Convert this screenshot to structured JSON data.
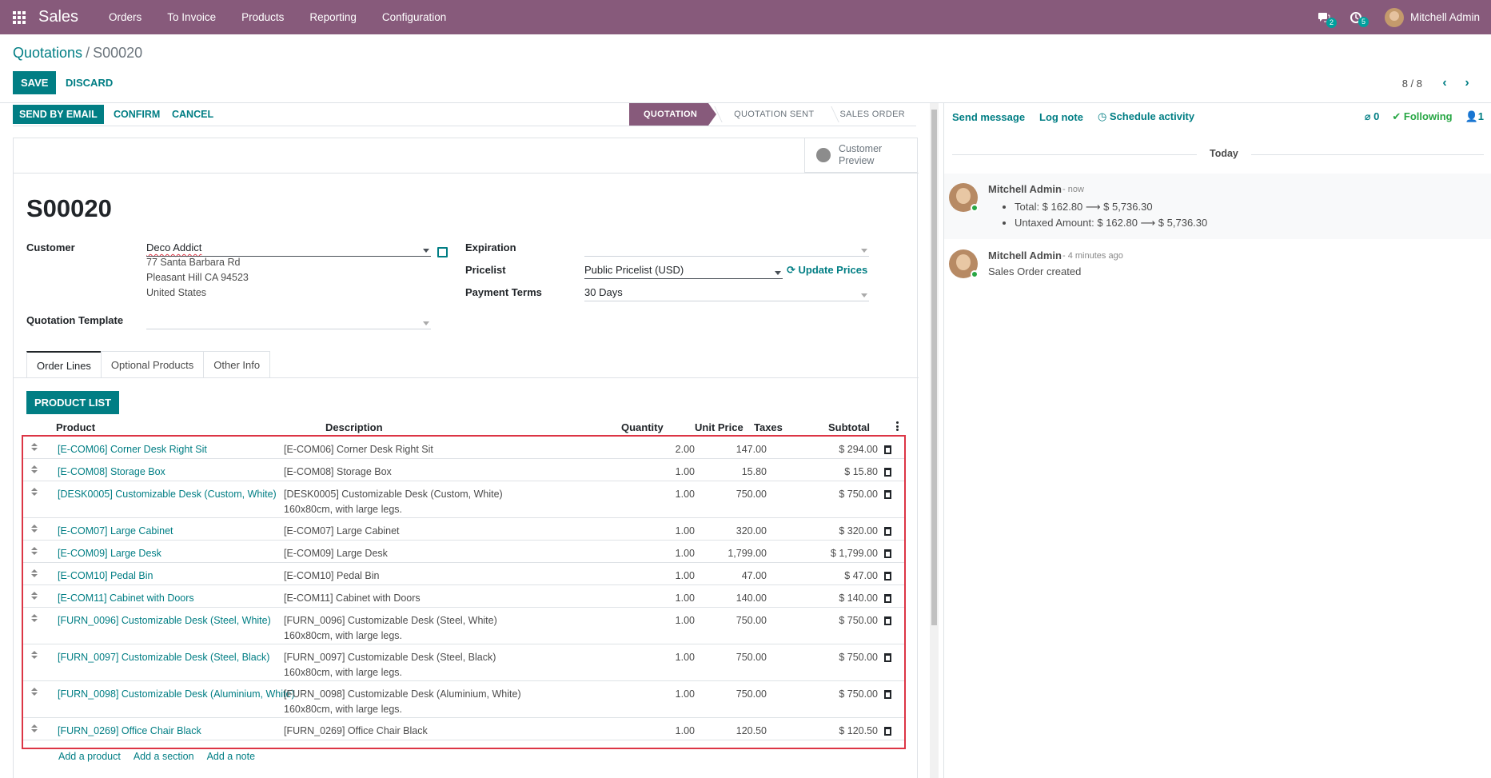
{
  "navbar": {
    "brand": "Sales",
    "menu": [
      "Orders",
      "To Invoice",
      "Products",
      "Reporting",
      "Configuration"
    ],
    "messages_badge": "2",
    "activities_badge": "5",
    "user": "Mitchell Admin"
  },
  "control": {
    "breadcrumb_parent": "Quotations",
    "breadcrumb_sep": "/",
    "breadcrumb_current": "S00020",
    "save": "SAVE",
    "discard": "DISCARD",
    "pager": "8 / 8"
  },
  "statusbar": {
    "send_email": "SEND BY EMAIL",
    "confirm": "CONFIRM",
    "cancel": "CANCEL",
    "stages": [
      "QUOTATION",
      "QUOTATION SENT",
      "SALES ORDER"
    ]
  },
  "form": {
    "customer_preview_1": "Customer",
    "customer_preview_2": "Preview",
    "title": "S00020",
    "customer_label": "Customer",
    "customer_value": "Deco Addict",
    "address": [
      "77 Santa Barbara Rd",
      "Pleasant Hill CA 94523",
      "United States"
    ],
    "quotation_template_label": "Quotation Template",
    "expiration_label": "Expiration",
    "pricelist_label": "Pricelist",
    "pricelist_value": "Public Pricelist (USD)",
    "update_prices": "Update Prices",
    "payment_terms_label": "Payment Terms",
    "payment_terms_value": "30 Days"
  },
  "tabs": [
    "Order Lines",
    "Optional Products",
    "Other Info"
  ],
  "order_lines": {
    "product_list_button": "PRODUCT LIST",
    "headers": {
      "product": "Product",
      "description": "Description",
      "quantity": "Quantity",
      "unit_price": "Unit Price",
      "taxes": "Taxes",
      "subtotal": "Subtotal"
    },
    "rows": [
      {
        "product": "[E-COM06] Corner Desk Right Sit",
        "desc1": "[E-COM06] Corner Desk Right Sit",
        "desc2": "",
        "qty": "2.00",
        "price": "147.00",
        "subtotal": "$ 294.00"
      },
      {
        "product": "[E-COM08] Storage Box",
        "desc1": "[E-COM08] Storage Box",
        "desc2": "",
        "qty": "1.00",
        "price": "15.80",
        "subtotal": "$ 15.80"
      },
      {
        "product": "[DESK0005] Customizable Desk (Custom, White)",
        "desc1": "[DESK0005] Customizable Desk (Custom, White)",
        "desc2": "160x80cm, with large legs.",
        "qty": "1.00",
        "price": "750.00",
        "subtotal": "$ 750.00"
      },
      {
        "product": "[E-COM07] Large Cabinet",
        "desc1": "[E-COM07] Large Cabinet",
        "desc2": "",
        "qty": "1.00",
        "price": "320.00",
        "subtotal": "$ 320.00"
      },
      {
        "product": "[E-COM09] Large Desk",
        "desc1": "[E-COM09] Large Desk",
        "desc2": "",
        "qty": "1.00",
        "price": "1,799.00",
        "subtotal": "$ 1,799.00"
      },
      {
        "product": "[E-COM10] Pedal Bin",
        "desc1": "[E-COM10] Pedal Bin",
        "desc2": "",
        "qty": "1.00",
        "price": "47.00",
        "subtotal": "$ 47.00"
      },
      {
        "product": "[E-COM11] Cabinet with Doors",
        "desc1": "[E-COM11] Cabinet with Doors",
        "desc2": "",
        "qty": "1.00",
        "price": "140.00",
        "subtotal": "$ 140.00"
      },
      {
        "product": "[FURN_0096] Customizable Desk (Steel, White)",
        "desc1": "[FURN_0096] Customizable Desk (Steel, White)",
        "desc2": "160x80cm, with large legs.",
        "qty": "1.00",
        "price": "750.00",
        "subtotal": "$ 750.00"
      },
      {
        "product": "[FURN_0097] Customizable Desk (Steel, Black)",
        "desc1": "[FURN_0097] Customizable Desk (Steel, Black)",
        "desc2": "160x80cm, with large legs.",
        "qty": "1.00",
        "price": "750.00",
        "subtotal": "$ 750.00"
      },
      {
        "product": "[FURN_0098] Customizable Desk (Aluminium, White)",
        "desc1": "[FURN_0098] Customizable Desk (Aluminium, White)",
        "desc2": "160x80cm, with large legs.",
        "qty": "1.00",
        "price": "750.00",
        "subtotal": "$ 750.00"
      },
      {
        "product": "[FURN_0269] Office Chair Black",
        "desc1": "[FURN_0269] Office Chair Black",
        "desc2": "",
        "qty": "1.00",
        "price": "120.50",
        "subtotal": "$ 120.50"
      }
    ],
    "add_product": "Add a product",
    "add_section": "Add a section",
    "add_note": "Add a note"
  },
  "chatter": {
    "send_message": "Send message",
    "log_note": "Log note",
    "schedule_activity": "Schedule activity",
    "attachments": "0",
    "following": "Following",
    "followers": "1",
    "today": "Today",
    "messages": [
      {
        "author": "Mitchell Admin",
        "date": "- now",
        "tracking": [
          "Total: $ 162.80 ⟶ $ 5,736.30",
          "Untaxed Amount: $ 162.80 ⟶ $ 5,736.30"
        ]
      },
      {
        "author": "Mitchell Admin",
        "date": "- 4 minutes ago",
        "body": "Sales Order created"
      }
    ]
  },
  "colors": {
    "brand": "#875a7b",
    "primary": "#017e84",
    "highlight_border": "#dc3545"
  }
}
